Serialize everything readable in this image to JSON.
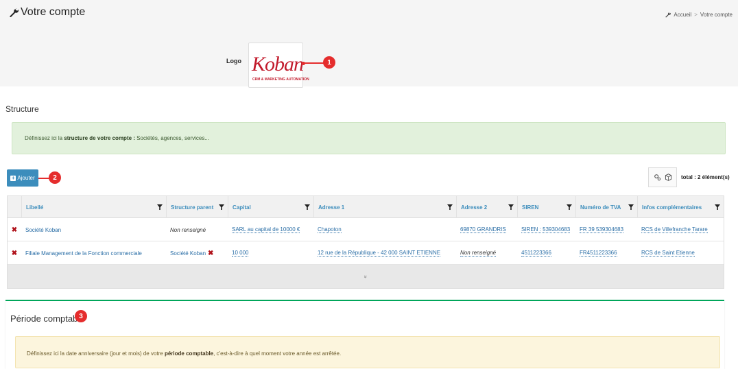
{
  "header": {
    "title": "Votre compte",
    "breadcrumb_home": "Accueil",
    "breadcrumb_sep": ">",
    "breadcrumb_current": "Votre compte"
  },
  "logo": {
    "label": "Logo",
    "brand": "Koban",
    "tagline": "CRM & MARKETING AUTOMATION"
  },
  "callouts": [
    "1",
    "2",
    "3"
  ],
  "structure": {
    "title": "Structure",
    "info_prefix": "Définissez ici la ",
    "info_bold": "structure de votre compte :",
    "info_suffix": " Sociétés, agences, services...",
    "add_label": "Ajouter",
    "total": "total : 2 élément(s)",
    "columns": [
      "Libellé",
      "Structure parent",
      "Capital",
      "Adresse 1",
      "Adresse 2",
      "SIREN",
      "Numéro de TVA",
      "Infos complémentaires"
    ],
    "rows": [
      {
        "libelle": "Société Koban",
        "parent": "Non renseigné",
        "capital": "SARL au capital de 10000 €",
        "adresse1": "Chapoton",
        "adresse2": "69870 GRANDRIS",
        "siren": "SIREN : 539304683",
        "tva": "FR 39 539304683",
        "infos": "RCS de Villefranche Tarare"
      },
      {
        "libelle": "Filiale Management de la Fonction commerciale",
        "parent": "Société Koban",
        "capital": "10 000",
        "adresse1": "12 rue de la République - 42 000 SAINT ETIENNE",
        "adresse2": "Non renseigné",
        "siren": "4511223366",
        "tva": "FR4511223366",
        "infos": "RCS de Saint Etienne"
      }
    ],
    "expand_glyph": "»"
  },
  "periode": {
    "title": "Période comptable",
    "info_prefix": "Définissez ici la date anniversaire (jour et mois) de votre ",
    "info_bold": "période comptable",
    "info_suffix": ", c'est-à-dire à quel moment votre année est arrêtée."
  },
  "colors": {
    "accent": "#3c8dbc",
    "callout": "#e52d2d",
    "delete": "#b0121b",
    "success": "#00a65a",
    "brand": "#c21b2c"
  },
  "icons": [
    "wrench-icon",
    "filter-icon",
    "delete-icon",
    "gears-icon",
    "box-icon",
    "plus-icon",
    "expand-icon"
  ]
}
